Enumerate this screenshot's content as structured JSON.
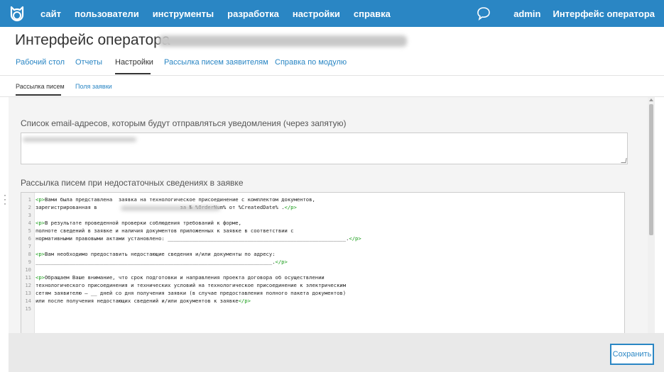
{
  "topbar": {
    "nav": [
      "сайт",
      "пользователи",
      "инструменты",
      "разработка",
      "настройки",
      "справка"
    ],
    "right": {
      "user": "admin",
      "app": "Интерфейс оператора"
    },
    "colors": {
      "bar": "#2a86c4"
    }
  },
  "page": {
    "title": "Интерфейс оператора"
  },
  "tabs": [
    "Рабочий стол",
    "Отчеты",
    "Настройки",
    "Рассылка писем заявителям",
    "Справка по модулю"
  ],
  "subtabs": [
    "Рассылка писем",
    "Поля заявки"
  ],
  "settings": {
    "email_label": "Список email-адресов, которым будут отправляться уведомления (через запятую)",
    "mailing_label": "Рассылка писем при недостаточных сведениях в заявке"
  },
  "editor": {
    "lines": [
      {
        "num": "1",
        "parts": [
          [
            "tag",
            "<p>"
          ],
          [
            "txt",
            "Вами была представлена  заявка на технологическое присоединение с комплектом документов,"
          ]
        ]
      },
      {
        "num": "2",
        "parts": [
          [
            "txt",
            "зарегистрированная в "
          ],
          [
            "txt",
            "                         "
          ],
          [
            "txt",
            " за № %OrderNum% от %CreatedDate% ."
          ],
          [
            "tag",
            "</p>"
          ]
        ]
      },
      {
        "num": "3",
        "parts": []
      },
      {
        "num": "4",
        "parts": [
          [
            "tag",
            "<p>"
          ],
          [
            "txt",
            "В результате проведенной проверки соблюдения требований к форме,"
          ]
        ]
      },
      {
        "num": "5",
        "parts": [
          [
            "txt",
            "полноте сведений в заявке и наличия документов приложенных к заявке в соответствии с"
          ]
        ]
      },
      {
        "num": "6",
        "parts": [
          [
            "txt",
            "нормативными правовыми актами установлено: "
          ],
          [
            "txt",
            "__________________________________________________________"
          ],
          [
            "txt",
            "."
          ],
          [
            "tag",
            "</p>"
          ]
        ]
      },
      {
        "num": "7",
        "parts": []
      },
      {
        "num": "8",
        "parts": [
          [
            "tag",
            "<p>"
          ],
          [
            "txt",
            "Вам необходимо предоставить недостающие сведения и/или документы по адресу:"
          ]
        ]
      },
      {
        "num": "9",
        "parts": [
          [
            "txt",
            "_____________________________________________________________________________."
          ],
          [
            "tag",
            "</p>"
          ]
        ]
      },
      {
        "num": "10",
        "parts": []
      },
      {
        "num": "11",
        "parts": [
          [
            "tag",
            "<p>"
          ],
          [
            "txt",
            "Обращаем Ваше внимание, что срок подготовки и направления проекта договора об осуществлении"
          ]
        ]
      },
      {
        "num": "12",
        "parts": [
          [
            "txt",
            "технологического присоединения и технических условий на технологическое присоединение к электрическим"
          ]
        ]
      },
      {
        "num": "13",
        "parts": [
          [
            "txt",
            "сетям заявителю – __ дней со дня получения заявки (в случае предоставления полного пакета документов)"
          ]
        ]
      },
      {
        "num": "14",
        "parts": [
          [
            "txt",
            "или после получения недостающих сведений и/или документов к заявке"
          ],
          [
            "tag",
            "</p>"
          ]
        ]
      },
      {
        "num": "15",
        "parts": []
      }
    ]
  },
  "footer": {
    "save_label": "Сохранить"
  }
}
